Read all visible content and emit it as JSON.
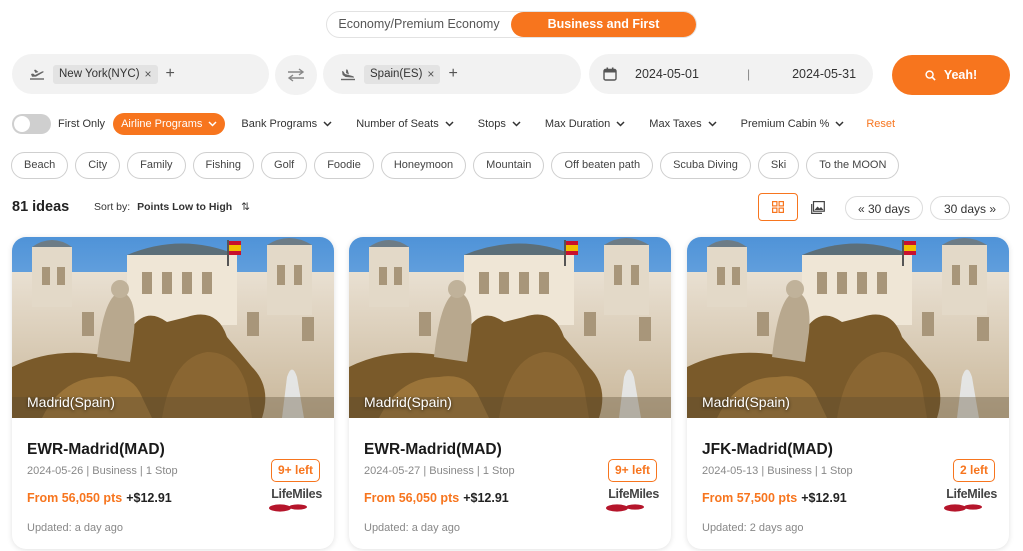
{
  "cabin": {
    "options": [
      "Economy/Premium Economy",
      "Business and First"
    ],
    "selected": "Business and First"
  },
  "search": {
    "origin": "New York(NYC)",
    "destination": "Spain(ES)",
    "date_start": "2024-05-01",
    "date_end": "2024-05-31",
    "go_label": "Yeah!"
  },
  "filters": {
    "first_only_label": "First Only",
    "items": [
      "Airline Programs",
      "Bank Programs",
      "Number of Seats",
      "Stops",
      "Max Duration",
      "Max Taxes",
      "Premium Cabin %"
    ],
    "reset_label": "Reset"
  },
  "tags": [
    "Beach",
    "City",
    "Family",
    "Fishing",
    "Golf",
    "Foodie",
    "Honeymoon",
    "Mountain",
    "Off beaten path",
    "Scuba Diving",
    "Ski",
    "To the MOON"
  ],
  "results": {
    "count_label": "81 ideas",
    "sort_prefix": "Sort by:",
    "sort_value": "Points Low to High",
    "prev_days": "30 days",
    "next_days": "30 days"
  },
  "cards": [
    {
      "city": "Madrid(Spain)",
      "route": "EWR-Madrid(MAD)",
      "meta": "2024-05-26 | Business | 1 Stop",
      "points": "From 56,050 pts",
      "tax": "+$12.91",
      "seats": "9+ left",
      "program": "LifeMiles",
      "updated": "Updated: a day ago"
    },
    {
      "city": "Madrid(Spain)",
      "route": "EWR-Madrid(MAD)",
      "meta": "2024-05-27 | Business | 1 Stop",
      "points": "From 56,050 pts",
      "tax": "+$12.91",
      "seats": "9+ left",
      "program": "LifeMiles",
      "updated": "Updated: a day ago"
    },
    {
      "city": "Madrid(Spain)",
      "route": "JFK-Madrid(MAD)",
      "meta": "2024-05-13 | Business | 1 Stop",
      "points": "From 57,500 pts",
      "tax": "+$12.91",
      "seats": "2 left",
      "program": "LifeMiles",
      "updated": "Updated: 2 days ago"
    }
  ],
  "colors": {
    "accent": "#f7751e",
    "field_bg": "#f2f2f2",
    "lifemiles_red": "#b5152b"
  }
}
